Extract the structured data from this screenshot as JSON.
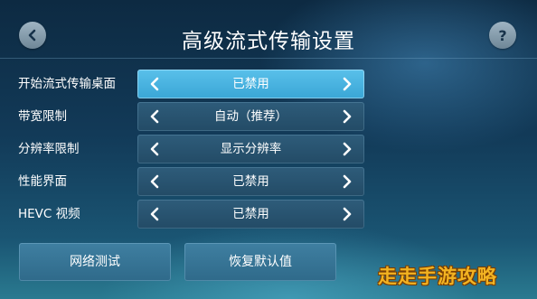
{
  "header": {
    "title": "高级流式传输设置",
    "back_icon": "chevron-left-icon",
    "help_label": "?"
  },
  "settings": [
    {
      "label": "开始流式传输桌面",
      "value": "已禁用",
      "active": true
    },
    {
      "label": "带宽限制",
      "value": "自动（推荐）",
      "active": false
    },
    {
      "label": "分辨率限制",
      "value": "显示分辨率",
      "active": false
    },
    {
      "label": "性能界面",
      "value": "已禁用",
      "active": false
    },
    {
      "label": "HEVC 视频",
      "value": "已禁用",
      "active": false
    }
  ],
  "buttons": {
    "network_test": "网络测试",
    "restore_defaults": "恢复默认值"
  },
  "watermark": "走走手游攻略",
  "colors": {
    "active_selector": "#3aa6d6",
    "selector": "#234b66",
    "button": "#2f6a8a",
    "watermark": "#f2b322"
  }
}
